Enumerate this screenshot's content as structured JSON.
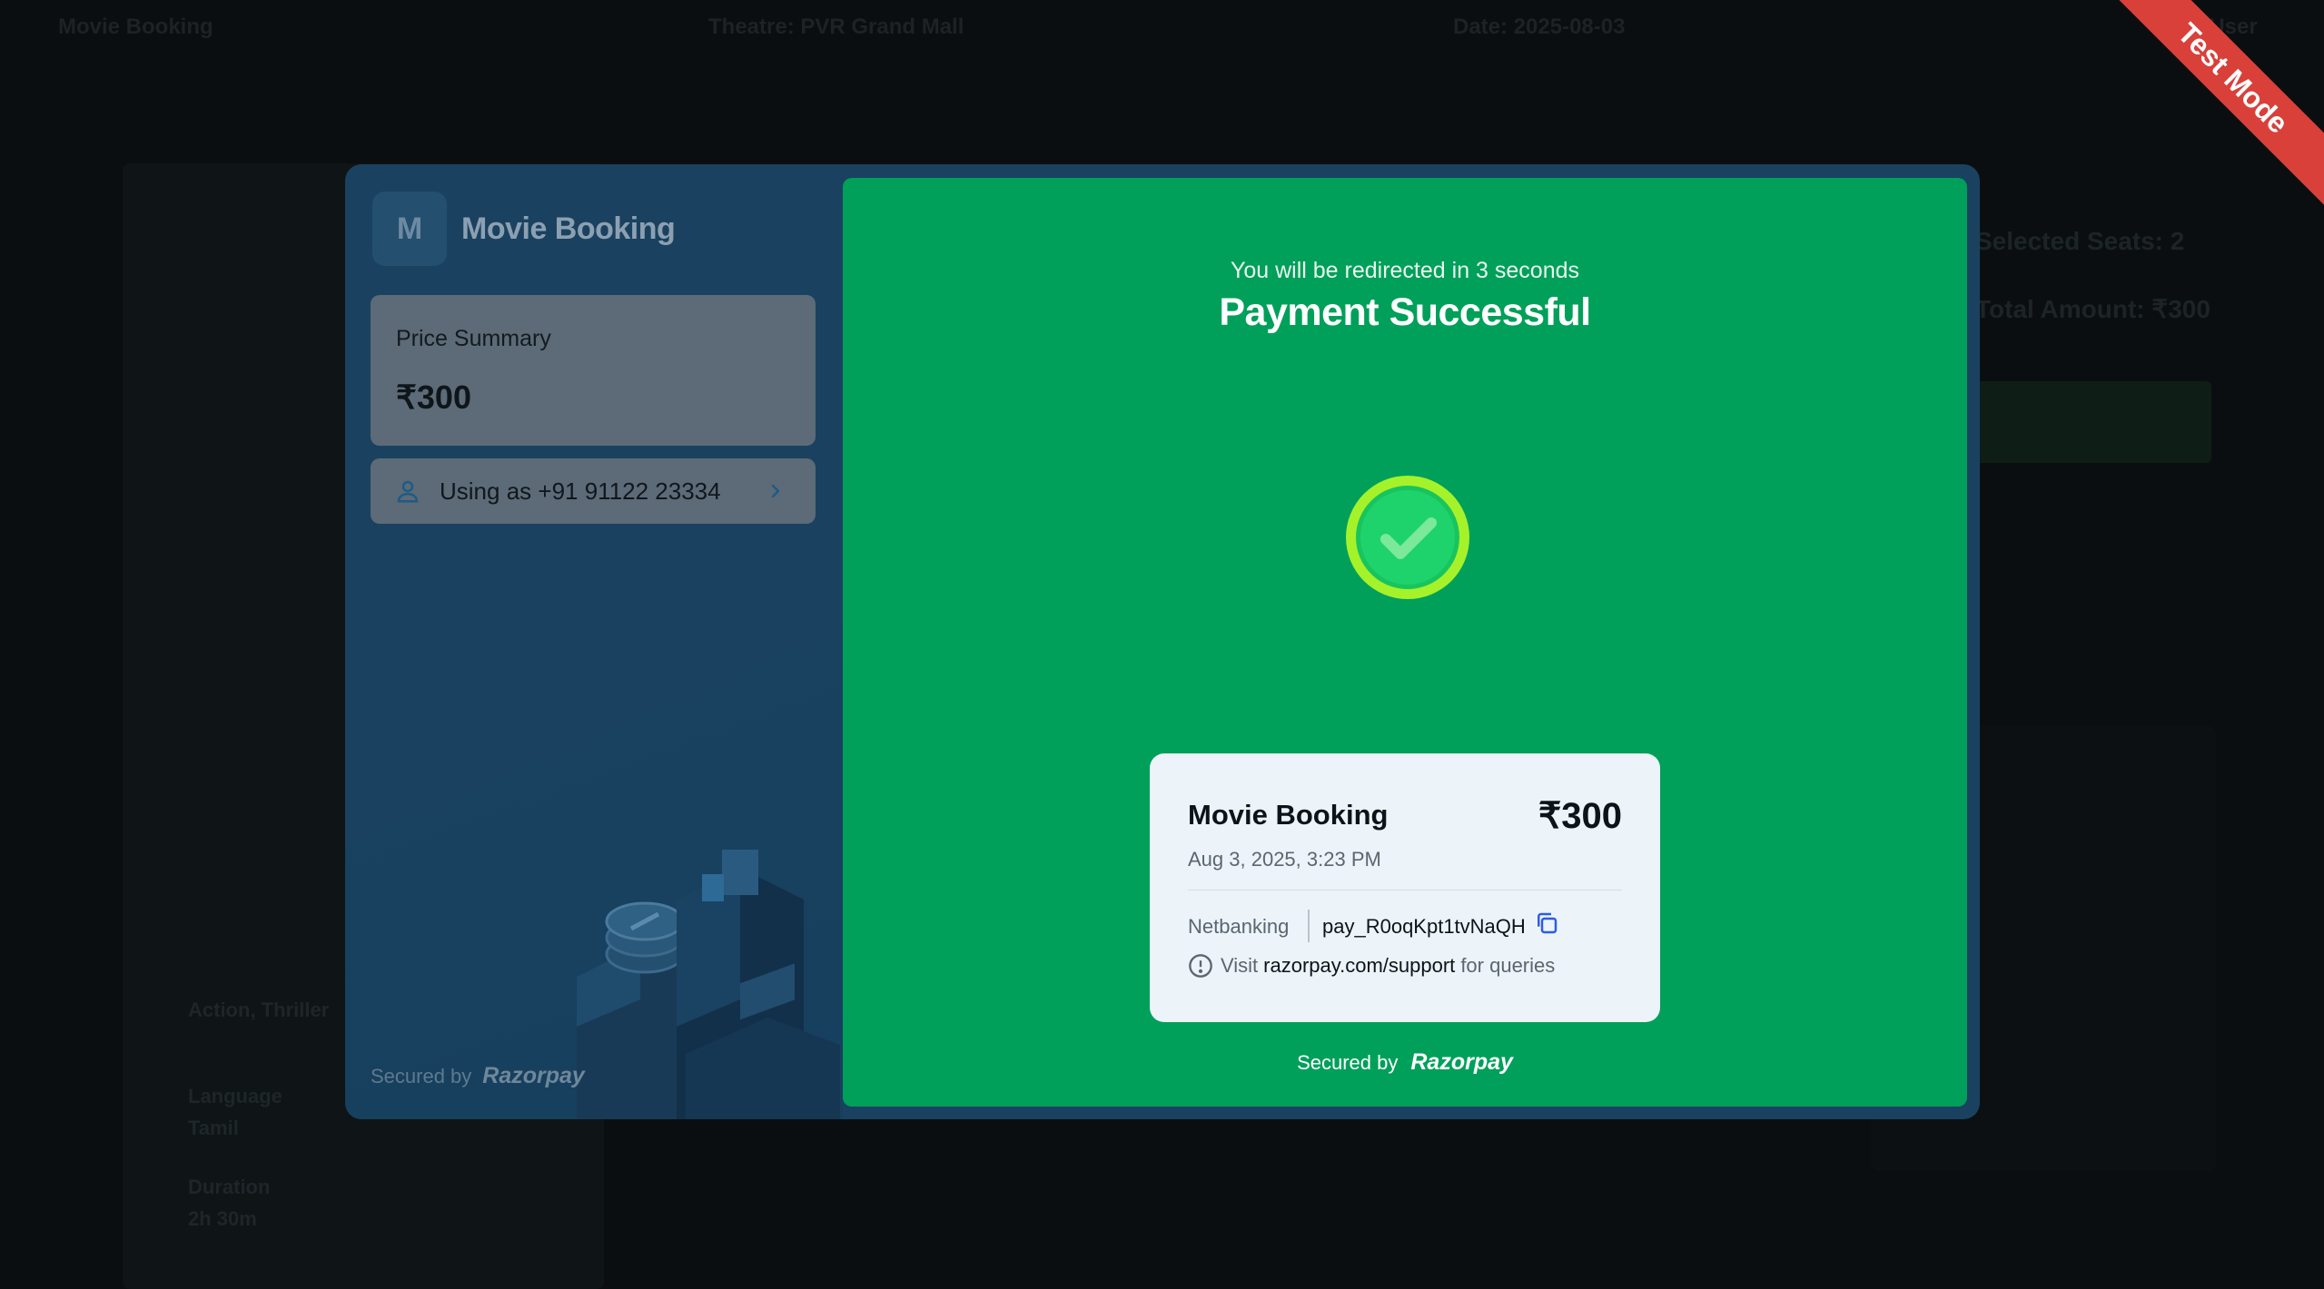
{
  "background": {
    "topbar_items": [
      "Movie Booking",
      "Theatre: PVR Grand Mall",
      "Date: 2025-08-03",
      "Hi, User"
    ],
    "right_lines": [
      "Selected Seats: 2",
      "Total Amount: ₹300"
    ],
    "left_labels": [
      "Action, Thriller",
      "Language",
      "Tamil",
      "Duration",
      "2h 30m"
    ]
  },
  "ribbon": {
    "label": "Test Mode",
    "color": "#d9403a"
  },
  "checkout": {
    "brand": {
      "initial": "M",
      "name": "Movie Booking"
    },
    "price_summary": {
      "title": "Price Summary",
      "amount": "₹300"
    },
    "user": {
      "label": "Using as +91 91122 23334"
    },
    "secured_by": "Secured by",
    "razorpay_label": "Razorpay"
  },
  "success": {
    "redirect_text": "You will be redirected in 3 seconds",
    "title": "Payment Successful",
    "accent": "#00a05a",
    "receipt": {
      "merchant": "Movie Booking",
      "amount": "₹300",
      "date": "Aug 3, 2025, 3:23 PM",
      "method": "Netbanking",
      "payment_id": "pay_R0oqKpt1tvNaQH",
      "info_prefix": "Visit",
      "info_link": "razorpay.com/support",
      "info_suffix": "for queries"
    },
    "secured_by": "Secured by",
    "razorpay_label": "Razorpay"
  }
}
